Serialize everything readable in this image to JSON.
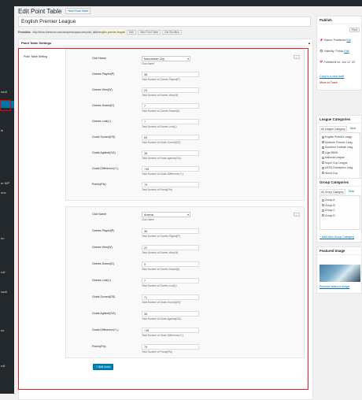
{
  "page": {
    "title": "Edit Point Table",
    "new_button": "New Point Table",
    "post_title": "English Premier League",
    "permalink_label": "Permalink:",
    "permalink_url": "http://demo.themeum.com/wordpress/wpsoccer/point_table/",
    "permalink_slug": "english-premier-league",
    "permalink_suffix": "/",
    "edit_btn": "Edit",
    "view_btn": "View Point Table",
    "shortlink_btn": "Get Shortlink"
  },
  "sidemenu": {
    "labels": [
      "rault",
      "ts",
      "er WP",
      "ons",
      "nu",
      "roll",
      "rault",
      "ns",
      "roll"
    ]
  },
  "metabox": {
    "header": "Point Table Settings",
    "toggle_icon": "▴",
    "setting_label": "Point Table Setting",
    "add_more": "+ Add more",
    "remove_label": "–"
  },
  "teams": [
    {
      "fields": [
        {
          "label": "Club Name",
          "value": "Manchester City",
          "hint": "Club Name",
          "type": "select"
        },
        {
          "label": "Games Played(P)",
          "value": "38",
          "hint": "Total Number of Games Played(P)",
          "type": "input"
        },
        {
          "label": "Games Won(W)",
          "value": "24",
          "hint": "Total Number of Games Won(W)",
          "type": "input"
        },
        {
          "label": "Games Drawn(D)",
          "value": "7",
          "hint": "Total Number of Games Drawn(D)",
          "type": "input"
        },
        {
          "label": "Games Lost(L)",
          "value": "7",
          "hint": "Total Number of Games Lost(L)",
          "type": "input"
        },
        {
          "label": "Goals Scored(GS)",
          "value": "83",
          "hint": "Total Number of Goals Scored(GS)",
          "type": "input"
        },
        {
          "label": "Goals Against(GA)",
          "value": "38",
          "hint": "Total Number of Goals Against(GA)",
          "type": "input"
        },
        {
          "label": "Goals Difference(+/-)",
          "value": "+45",
          "hint": "Total Number of Goals Difference(+/-)",
          "type": "input"
        },
        {
          "label": "Points(Pts)",
          "value": "79",
          "hint": "Total Number of Points(Pts)",
          "type": "input"
        }
      ]
    },
    {
      "fields": [
        {
          "label": "Club Name",
          "value": "Arsenal",
          "hint": "Club Name",
          "type": "select"
        },
        {
          "label": "Games Played(P)",
          "value": "38",
          "hint": "Total Number of Games Played(P)",
          "type": "input"
        },
        {
          "label": "Games Won(W)",
          "value": "22",
          "hint": "Total Number of Games Won(W)",
          "type": "input"
        },
        {
          "label": "Games Drawn(D)",
          "value": "9",
          "hint": "Total Number of Games Drawn(D)",
          "type": "input"
        },
        {
          "label": "Games Lost(L)",
          "value": "7",
          "hint": "Total Number of Games Lost(L)",
          "type": "input"
        },
        {
          "label": "Goals Scored(GS)",
          "value": "71",
          "hint": "Total Number of Goals Scored(GS)",
          "type": "input"
        },
        {
          "label": "Goals Against(GA)",
          "value": "36",
          "hint": "Total Number of Goals Against(GA)",
          "type": "input"
        },
        {
          "label": "Goals Difference(+/-)",
          "value": "+35",
          "hint": "Total Number of Goals Difference(+/-)",
          "type": "input"
        },
        {
          "label": "Points(Pts)",
          "value": "75",
          "hint": "Total Number of Points(Pts)",
          "type": "input"
        }
      ]
    }
  ],
  "publish": {
    "header": "Publish",
    "preview_btn": "Previ",
    "status": "Status: Published",
    "status_edit": "Edi",
    "visibility": "Visibility: Public",
    "visibility_edit": "Edit",
    "published_on": "Published on: Jun 12, 20",
    "copy_draft": "Copy to a new draft",
    "trash": "Move to Trash"
  },
  "league_categories": {
    "header": "League Categories",
    "tab_all": "All League Category",
    "tab_most": "Most",
    "items": [
      {
        "label": "English Premier Leagu",
        "checked": true
      },
      {
        "label": "Northern Premier Leag",
        "checked": true
      },
      {
        "label": "Southern Football Leag",
        "checked": true
      },
      {
        "label": "Liga BBVA",
        "checked": false
      },
      {
        "label": "National League",
        "checked": false
      },
      {
        "label": "Super Cup League",
        "checked": false
      },
      {
        "label": "UEFA Champions Leag",
        "checked": false
      },
      {
        "label": "World Cup",
        "checked": false
      }
    ],
    "add_new": "+ Add New League Category"
  },
  "group_categories": {
    "header": "Group Categories",
    "tab_all": "All Group Category",
    "tab_most": "Most",
    "items": [
      {
        "label": "Group A",
        "checked": false
      },
      {
        "label": "Group B",
        "checked": false
      },
      {
        "label": "Group C",
        "checked": false
      },
      {
        "label": "Group D",
        "checked": false
      }
    ],
    "add_new": "+ Add New Group Category"
  },
  "featured_image": {
    "header": "Featured Image",
    "remove": "Remove featured image"
  }
}
